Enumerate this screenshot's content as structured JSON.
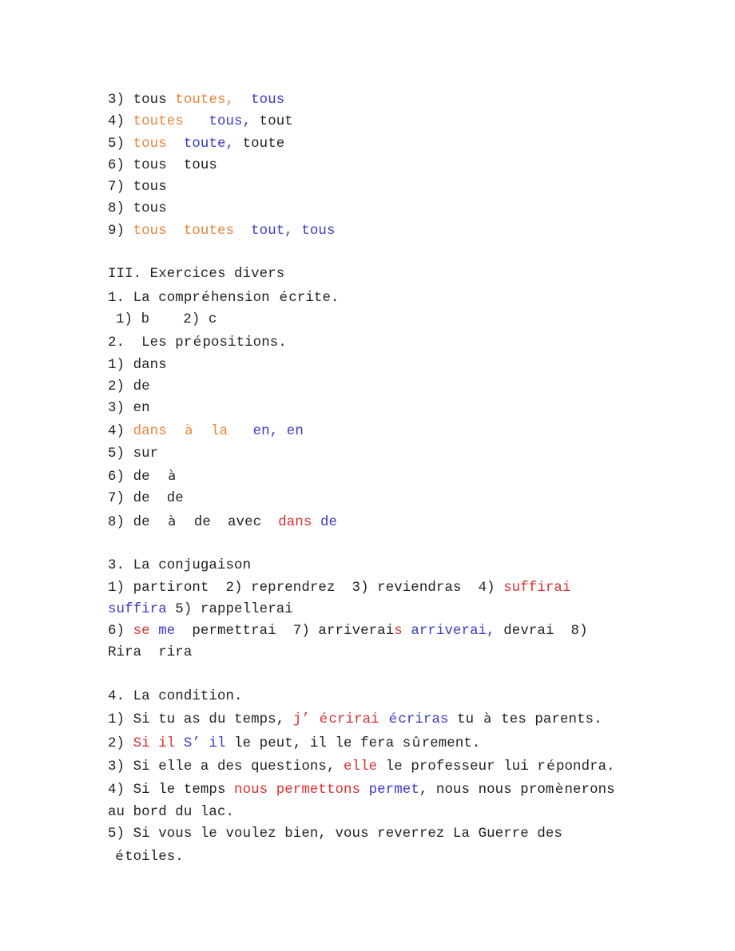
{
  "document": {
    "colors": {
      "ink": "#231f20",
      "orange": "#e8833a",
      "red": "#d93030",
      "blue": "#3a3ac8",
      "background": "#ffffff"
    },
    "blocks": [
      {
        "name": "tout-answers",
        "lines": [
          {
            "name": "answer-line-3",
            "runs": [
              {
                "t": "3) tous ",
                "c": "k"
              },
              {
                "t": "toutes,",
                "c": "o"
              },
              {
                "t": "  ",
                "c": "k"
              },
              {
                "t": "tous",
                "c": "b"
              }
            ]
          },
          {
            "name": "answer-line-4",
            "runs": [
              {
                "t": "4) ",
                "c": "k"
              },
              {
                "t": "toutes",
                "c": "o"
              },
              {
                "t": "   ",
                "c": "k"
              },
              {
                "t": "tous,",
                "c": "b"
              },
              {
                "t": " tout",
                "c": "k"
              }
            ]
          },
          {
            "name": "answer-line-5",
            "runs": [
              {
                "t": "5) ",
                "c": "k"
              },
              {
                "t": "tous",
                "c": "o"
              },
              {
                "t": "  ",
                "c": "k"
              },
              {
                "t": "toute,",
                "c": "b"
              },
              {
                "t": " toute",
                "c": "k"
              }
            ]
          },
          {
            "name": "answer-line-6",
            "runs": [
              {
                "t": "6) tous  tous",
                "c": "k"
              }
            ]
          },
          {
            "name": "answer-line-7",
            "runs": [
              {
                "t": "7) tous",
                "c": "k"
              }
            ]
          },
          {
            "name": "answer-line-8",
            "runs": [
              {
                "t": "8) tous",
                "c": "k"
              }
            ]
          },
          {
            "name": "answer-line-9",
            "runs": [
              {
                "t": "9) ",
                "c": "k"
              },
              {
                "t": "tous",
                "c": "o"
              },
              {
                "t": "  ",
                "c": "k"
              },
              {
                "t": "toutes",
                "c": "o"
              },
              {
                "t": "  ",
                "c": "k"
              },
              {
                "t": "tout, tous",
                "c": "b"
              }
            ]
          }
        ]
      },
      {
        "name": "section-iii",
        "lines": [
          {
            "name": "section-heading-iii",
            "runs": [
              {
                "t": "III. Exercices divers",
                "c": "k"
              }
            ]
          },
          {
            "name": "subsection-1-heading",
            "runs": [
              {
                "t": "1. La compr",
                "c": "k"
              },
              {
                "t": "é",
                "c": "k",
                "acc": true
              },
              {
                "t": "hension ",
                "c": "k"
              },
              {
                "t": "é",
                "c": "k",
                "acc": true
              },
              {
                "t": "crite.",
                "c": "k"
              }
            ]
          },
          {
            "name": "comprehension-answers",
            "indent": "ind1",
            "runs": [
              {
                "t": "1) b    2) c",
                "c": "k"
              }
            ]
          },
          {
            "name": "subsection-2-heading",
            "runs": [
              {
                "t": "2.  Les pr",
                "c": "k"
              },
              {
                "t": "é",
                "c": "k",
                "acc": true
              },
              {
                "t": "positions.",
                "c": "k"
              }
            ]
          },
          {
            "name": "preposition-line-1",
            "runs": [
              {
                "t": "1) dans",
                "c": "k"
              }
            ]
          },
          {
            "name": "preposition-line-2",
            "runs": [
              {
                "t": "2) de",
                "c": "k"
              }
            ]
          },
          {
            "name": "preposition-line-3",
            "runs": [
              {
                "t": "3) en",
                "c": "k"
              }
            ]
          },
          {
            "name": "preposition-line-4",
            "runs": [
              {
                "t": "4) ",
                "c": "k"
              },
              {
                "t": "dans",
                "c": "o"
              },
              {
                "t": "  ",
                "c": "k"
              },
              {
                "t": "à",
                "c": "o",
                "acc": true
              },
              {
                "t": "  ",
                "c": "k"
              },
              {
                "t": "la",
                "c": "o"
              },
              {
                "t": "   ",
                "c": "k"
              },
              {
                "t": "en, en",
                "c": "b"
              }
            ]
          },
          {
            "name": "preposition-line-5",
            "runs": [
              {
                "t": "5) sur",
                "c": "k"
              }
            ]
          },
          {
            "name": "preposition-line-6",
            "runs": [
              {
                "t": "6) de  ",
                "c": "k"
              },
              {
                "t": "à",
                "c": "k",
                "acc": true
              }
            ]
          },
          {
            "name": "preposition-line-7",
            "runs": [
              {
                "t": "7) de  de",
                "c": "k"
              }
            ]
          },
          {
            "name": "preposition-line-8",
            "runs": [
              {
                "t": "8) de  ",
                "c": "k"
              },
              {
                "t": "à",
                "c": "k",
                "acc": true
              },
              {
                "t": "  de  avec  ",
                "c": "k"
              },
              {
                "t": "dans",
                "c": "r"
              },
              {
                "t": " ",
                "c": "k"
              },
              {
                "t": "de",
                "c": "b"
              }
            ]
          }
        ]
      },
      {
        "name": "subsection-3-conjugation",
        "lines": [
          {
            "name": "subsection-3-heading",
            "runs": [
              {
                "t": "3. La conjugaison",
                "c": "k"
              }
            ]
          },
          {
            "name": "conjugation-line-1",
            "runs": [
              {
                "t": "1) partiront  2) reprendrez  3) reviendras  4) ",
                "c": "k"
              },
              {
                "t": "suffirai",
                "c": "r"
              }
            ]
          },
          {
            "name": "conjugation-line-2",
            "runs": [
              {
                "t": "suffira",
                "c": "b"
              },
              {
                "t": " 5) rappellerai",
                "c": "k"
              }
            ]
          },
          {
            "name": "conjugation-line-3",
            "runs": [
              {
                "t": "6) ",
                "c": "k"
              },
              {
                "t": "se",
                "c": "r"
              },
              {
                "t": " ",
                "c": "k"
              },
              {
                "t": "me",
                "c": "b"
              },
              {
                "t": "  permettrai  7) arriverai",
                "c": "k"
              },
              {
                "t": "s",
                "c": "r"
              },
              {
                "t": " ",
                "c": "k"
              },
              {
                "t": "arriverai,",
                "c": "b"
              },
              {
                "t": " devrai  8)",
                "c": "k"
              }
            ]
          },
          {
            "name": "conjugation-line-4",
            "runs": [
              {
                "t": "Rira  rira",
                "c": "k"
              }
            ]
          }
        ]
      },
      {
        "name": "subsection-4-condition",
        "lines": [
          {
            "name": "subsection-4-heading",
            "runs": [
              {
                "t": "4. La condition.",
                "c": "k"
              }
            ]
          },
          {
            "name": "condition-line-1",
            "runs": [
              {
                "t": "1) Si tu as du temps, ",
                "c": "k"
              },
              {
                "t": "j’",
                "c": "r"
              },
              {
                "t": " ",
                "c": "k"
              },
              {
                "t": "é",
                "c": "r",
                "acc": true
              },
              {
                "t": "crirai",
                "c": "r"
              },
              {
                "t": " ",
                "c": "k"
              },
              {
                "t": "é",
                "c": "b",
                "acc": true
              },
              {
                "t": "criras",
                "c": "b"
              },
              {
                "t": " tu ",
                "c": "k"
              },
              {
                "t": "à",
                "c": "k",
                "acc": true
              },
              {
                "t": " tes parents.",
                "c": "k"
              }
            ]
          },
          {
            "name": "condition-line-2",
            "runs": [
              {
                "t": "2) ",
                "c": "k"
              },
              {
                "t": "Si il",
                "c": "r"
              },
              {
                "t": " ",
                "c": "k"
              },
              {
                "t": "S’ il",
                "c": "b"
              },
              {
                "t": " le peut, il le fera s",
                "c": "k"
              },
              {
                "t": "û",
                "c": "k",
                "acc": true
              },
              {
                "t": "rement.",
                "c": "k"
              }
            ]
          },
          {
            "name": "condition-line-3",
            "runs": [
              {
                "t": "3) Si elle a des questions, ",
                "c": "k"
              },
              {
                "t": "elle",
                "c": "r"
              },
              {
                "t": " le professeur lui r",
                "c": "k"
              },
              {
                "t": "é",
                "c": "k",
                "acc": true
              },
              {
                "t": "pondra.",
                "c": "k"
              }
            ]
          },
          {
            "name": "condition-line-4",
            "runs": [
              {
                "t": "4) Si le temps ",
                "c": "k"
              },
              {
                "t": "nous permettons",
                "c": "r"
              },
              {
                "t": " ",
                "c": "k"
              },
              {
                "t": "permet",
                "c": "b"
              },
              {
                "t": ", nous nous prom",
                "c": "k"
              },
              {
                "t": "è",
                "c": "k",
                "acc": true
              },
              {
                "t": "nerons",
                "c": "k"
              }
            ]
          },
          {
            "name": "condition-line-5",
            "runs": [
              {
                "t": "au bord du lac.",
                "c": "k"
              }
            ]
          },
          {
            "name": "condition-line-6",
            "runs": [
              {
                "t": "5) Si vous le voulez bien, vous reverrez La Guerre des",
                "c": "k"
              }
            ]
          },
          {
            "name": "condition-line-7",
            "indent": "ind2",
            "runs": [
              {
                "t": "é",
                "c": "k",
                "acc": true
              },
              {
                "t": "toiles.",
                "c": "k"
              }
            ]
          }
        ]
      }
    ]
  }
}
